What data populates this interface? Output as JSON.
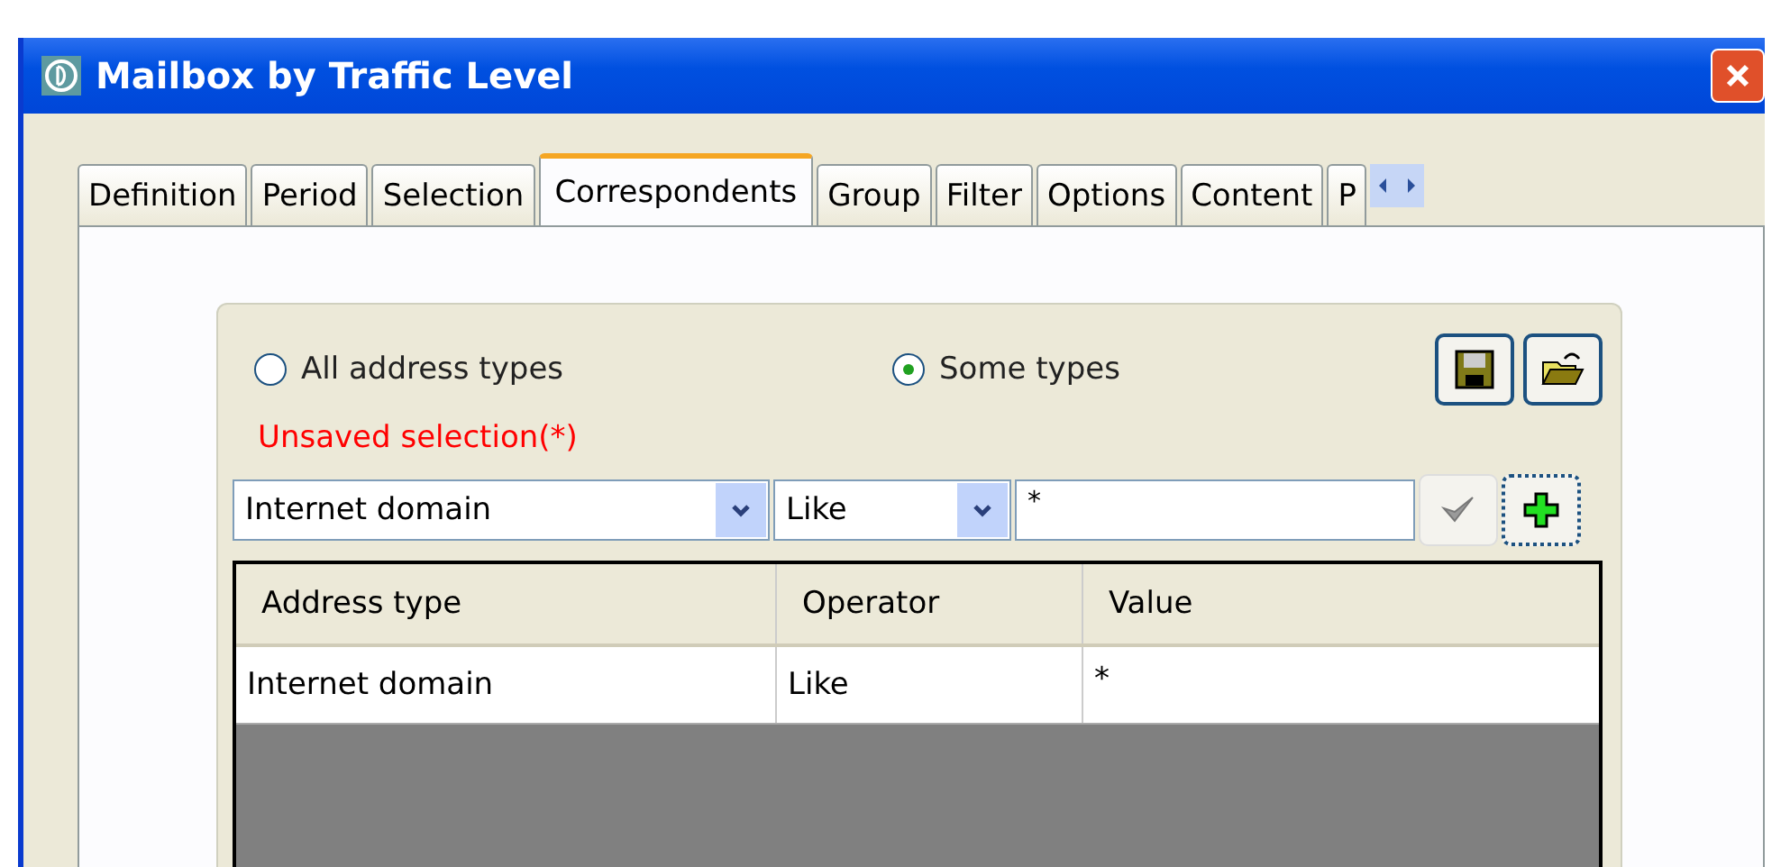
{
  "window": {
    "title": "Mailbox by Traffic Level"
  },
  "tabs": [
    {
      "label": "Definition",
      "selected": false
    },
    {
      "label": "Period",
      "selected": false
    },
    {
      "label": "Selection",
      "selected": false
    },
    {
      "label": "Correspondents",
      "selected": true
    },
    {
      "label": "Group",
      "selected": false
    },
    {
      "label": "Filter",
      "selected": false
    },
    {
      "label": "Options",
      "selected": false
    },
    {
      "label": "Content",
      "selected": false
    },
    {
      "label": "P",
      "selected": false
    }
  ],
  "scope": [
    {
      "label": "All address types",
      "selected": false
    },
    {
      "label": "Some types",
      "selected": true
    }
  ],
  "status": "Unsaved selection(*)",
  "criteria": {
    "address_type": "Internet domain",
    "operator": "Like",
    "value": "*"
  },
  "table": {
    "columns": [
      "Address type",
      "Operator",
      "Value"
    ],
    "rows": [
      [
        "Internet domain",
        "Like",
        "*"
      ]
    ]
  }
}
